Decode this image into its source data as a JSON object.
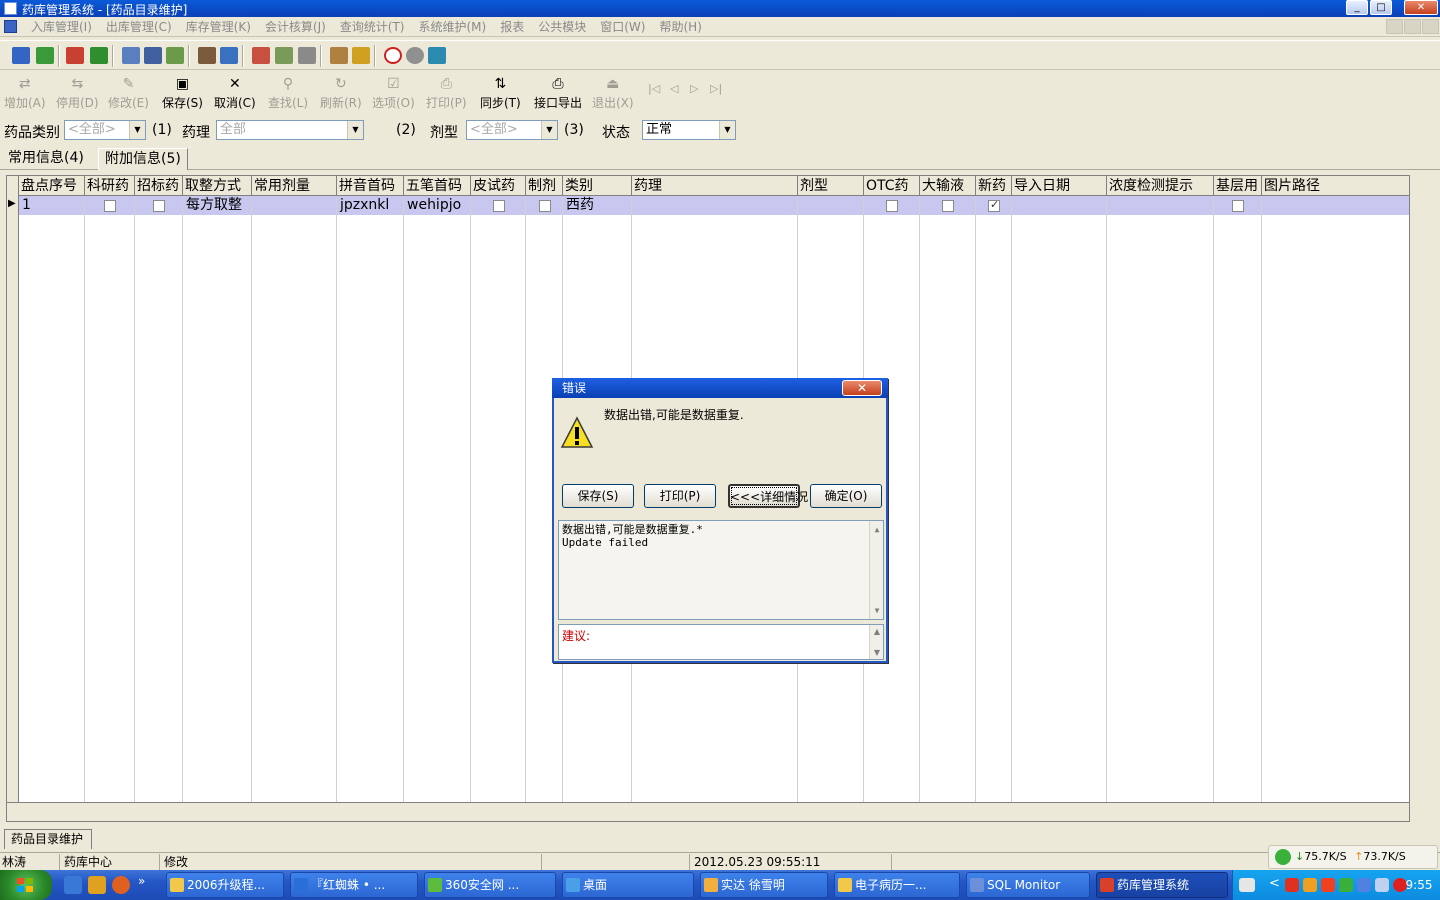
{
  "window": {
    "title": "药库管理系统 - [药品目录维护]",
    "min": "_",
    "max": "□",
    "close": "✕"
  },
  "menu": [
    "入库管理(I)",
    "出库管理(C)",
    "库存管理(K)",
    "会计核算(J)",
    "查询统计(T)",
    "系统维护(M)",
    "报表",
    "公共模块",
    "窗口(W)",
    "帮助(H)"
  ],
  "toolbar": [
    {
      "label": "增加(A)",
      "icon": "⇄",
      "enabled": false
    },
    {
      "label": "停用(D)",
      "icon": "⇆",
      "enabled": false
    },
    {
      "label": "修改(E)",
      "icon": "✎",
      "enabled": false
    },
    {
      "label": "保存(S)",
      "icon": "▣",
      "enabled": true
    },
    {
      "label": "取消(C)",
      "icon": "✕",
      "enabled": true
    },
    {
      "label": "查找(L)",
      "icon": "⚲",
      "enabled": false
    },
    {
      "label": "刷新(R)",
      "icon": "↻",
      "enabled": false
    },
    {
      "label": "选项(O)",
      "icon": "☑",
      "enabled": false
    },
    {
      "label": "打印(P)",
      "icon": "⎙",
      "enabled": false
    },
    {
      "label": "同步(T)",
      "icon": "⇅",
      "enabled": true
    },
    {
      "label": "接口导出",
      "icon": "⎙",
      "enabled": true
    },
    {
      "label": "退出(X)",
      "icon": "⏏",
      "enabled": false
    }
  ],
  "nav_arrows": [
    "|◁",
    "◁",
    "▷",
    "▷|"
  ],
  "filter": {
    "category_label": "药品类别",
    "category_value": "<全部>",
    "category_hint": "(1)",
    "pharm_label": "药理",
    "pharm_value": "全部",
    "pharm_hint": "(2)",
    "form_label": "剂型",
    "form_value": "<全部>",
    "form_hint": "(3)",
    "status_label": "状态",
    "status_value": "正常"
  },
  "tabs": [
    "常用信息(4)",
    "附加信息(5)"
  ],
  "grid": {
    "columns": [
      "盘点序号",
      "科研药",
      "招标药",
      "取整方式",
      "常用剂量",
      "拼音首码",
      "五笔首码",
      "皮试药",
      "制剂",
      "类别",
      "药理",
      "剂型",
      "OTC药",
      "大输液",
      "新药",
      "导入日期",
      "浓度检测提示",
      "基层用",
      "图片路径"
    ],
    "row": {
      "seq": "1",
      "rounding": "每方取整",
      "pinyin": "jpzxnkl",
      "wubi": "wehipjo",
      "category": "西药",
      "checked": {
        "科研药": false,
        "招标药": false,
        "皮试药": false,
        "制剂": false,
        "OTC药": false,
        "大输液": false,
        "新药": true,
        "基层用": false
      }
    }
  },
  "dialog": {
    "title": "错误",
    "message": "数据出错,可能是数据重复.",
    "buttons": [
      "保存(S)",
      "打印(P)",
      "<<<详细情况",
      "确定(O)"
    ],
    "details": "数据出错,可能是数据重复.*\nUpdate failed",
    "suggest_label": "建议:"
  },
  "form_tab": "药品目录维护",
  "status": {
    "user": "林涛",
    "dept": "药库中心",
    "mode": "修改",
    "datetime": "2012.05.23 09:55:11"
  },
  "network": {
    "down": "75.7K/S",
    "up": "73.7K/S"
  },
  "taskbar": {
    "tasks": [
      {
        "label": "2006升级程...",
        "color": "#f2c84b"
      },
      {
        "label": "『红蜘蛛 • ...",
        "color": "#2a6fd8"
      },
      {
        "label": "360安全网 ...",
        "color": "#5dbb3d"
      },
      {
        "label": "桌面",
        "color": "#4aa0e8"
      },
      {
        "label": "实达 徐雪明",
        "color": "#f0b040"
      },
      {
        "label": "电子病历一...",
        "color": "#f2c84b"
      },
      {
        "label": "SQL Monitor",
        "color": "#6b8fd9"
      },
      {
        "label": "药库管理系统",
        "color": "#d8402a"
      }
    ],
    "clock": "9:55"
  },
  "colors": {
    "accent": "#0b3fb6",
    "selected_row": "#c7c7ef",
    "taskbar": "#2456c4"
  }
}
